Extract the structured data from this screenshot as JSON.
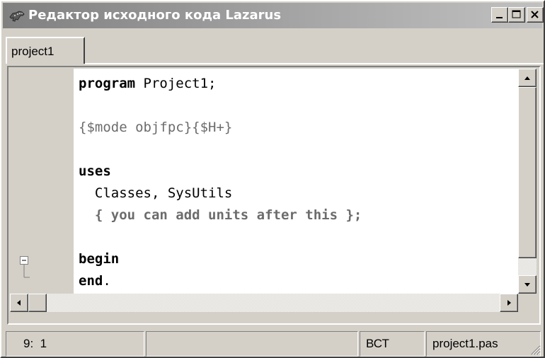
{
  "window": {
    "title": "Редактор исходного кода Lazarus",
    "controls": [
      "minimize",
      "maximize",
      "close"
    ]
  },
  "tabs": [
    {
      "label": "project1",
      "active": true
    }
  ],
  "editor": {
    "lines": [
      {
        "parts": [
          {
            "text": "program",
            "style": "keyword"
          },
          {
            "text": " Project1;",
            "style": "normal"
          }
        ]
      },
      {
        "parts": []
      },
      {
        "parts": [
          {
            "text": "{$mode objfpc}{$H+}",
            "style": "directive"
          }
        ]
      },
      {
        "parts": []
      },
      {
        "parts": [
          {
            "text": "uses",
            "style": "keyword"
          }
        ]
      },
      {
        "parts": [
          {
            "text": "  Classes, SysUtils",
            "style": "normal"
          }
        ]
      },
      {
        "parts": [
          {
            "text": "  { you can add units after this };",
            "style": "comment"
          }
        ]
      },
      {
        "parts": []
      },
      {
        "parts": [
          {
            "text": "begin",
            "style": "keyword"
          }
        ]
      },
      {
        "parts": [
          {
            "text": "end",
            "style": "keyword"
          },
          {
            "text": ".",
            "style": "normal"
          }
        ]
      }
    ]
  },
  "statusbar": {
    "position": "9:  1",
    "modified": "",
    "mode": "ВСТ",
    "filename": "project1.pas"
  },
  "colors": {
    "titlebar_start": "#808080",
    "titlebar_end": "#c0c0c0",
    "face": "#d4d0c8",
    "comment": "#6c6c6c"
  }
}
